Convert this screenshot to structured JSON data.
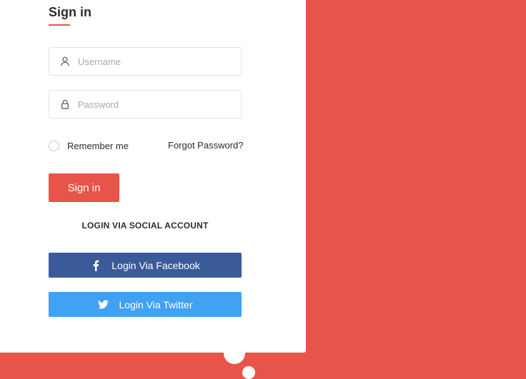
{
  "form": {
    "title": "Sign in",
    "username": {
      "placeholder": "Username",
      "value": "",
      "icon": "user-icon"
    },
    "password": {
      "placeholder": "Password",
      "value": "",
      "icon": "lock-icon"
    },
    "remember_label": "Remember me",
    "remember_checked": false,
    "forgot_label": "Forgot Password?",
    "signin_label": "Sign in"
  },
  "social": {
    "heading": "LOGIN VIA SOCIAL ACCOUNT",
    "facebook": {
      "label": "Login Via Facebook",
      "icon": "facebook-icon",
      "color": "#3b5a9a"
    },
    "twitter": {
      "label": "Login Via Twitter",
      "icon": "twitter-icon",
      "color": "#41a1f2"
    }
  },
  "colors": {
    "accent": "#e8534a",
    "card": "#ffffff",
    "text": "#2d2d2d"
  }
}
